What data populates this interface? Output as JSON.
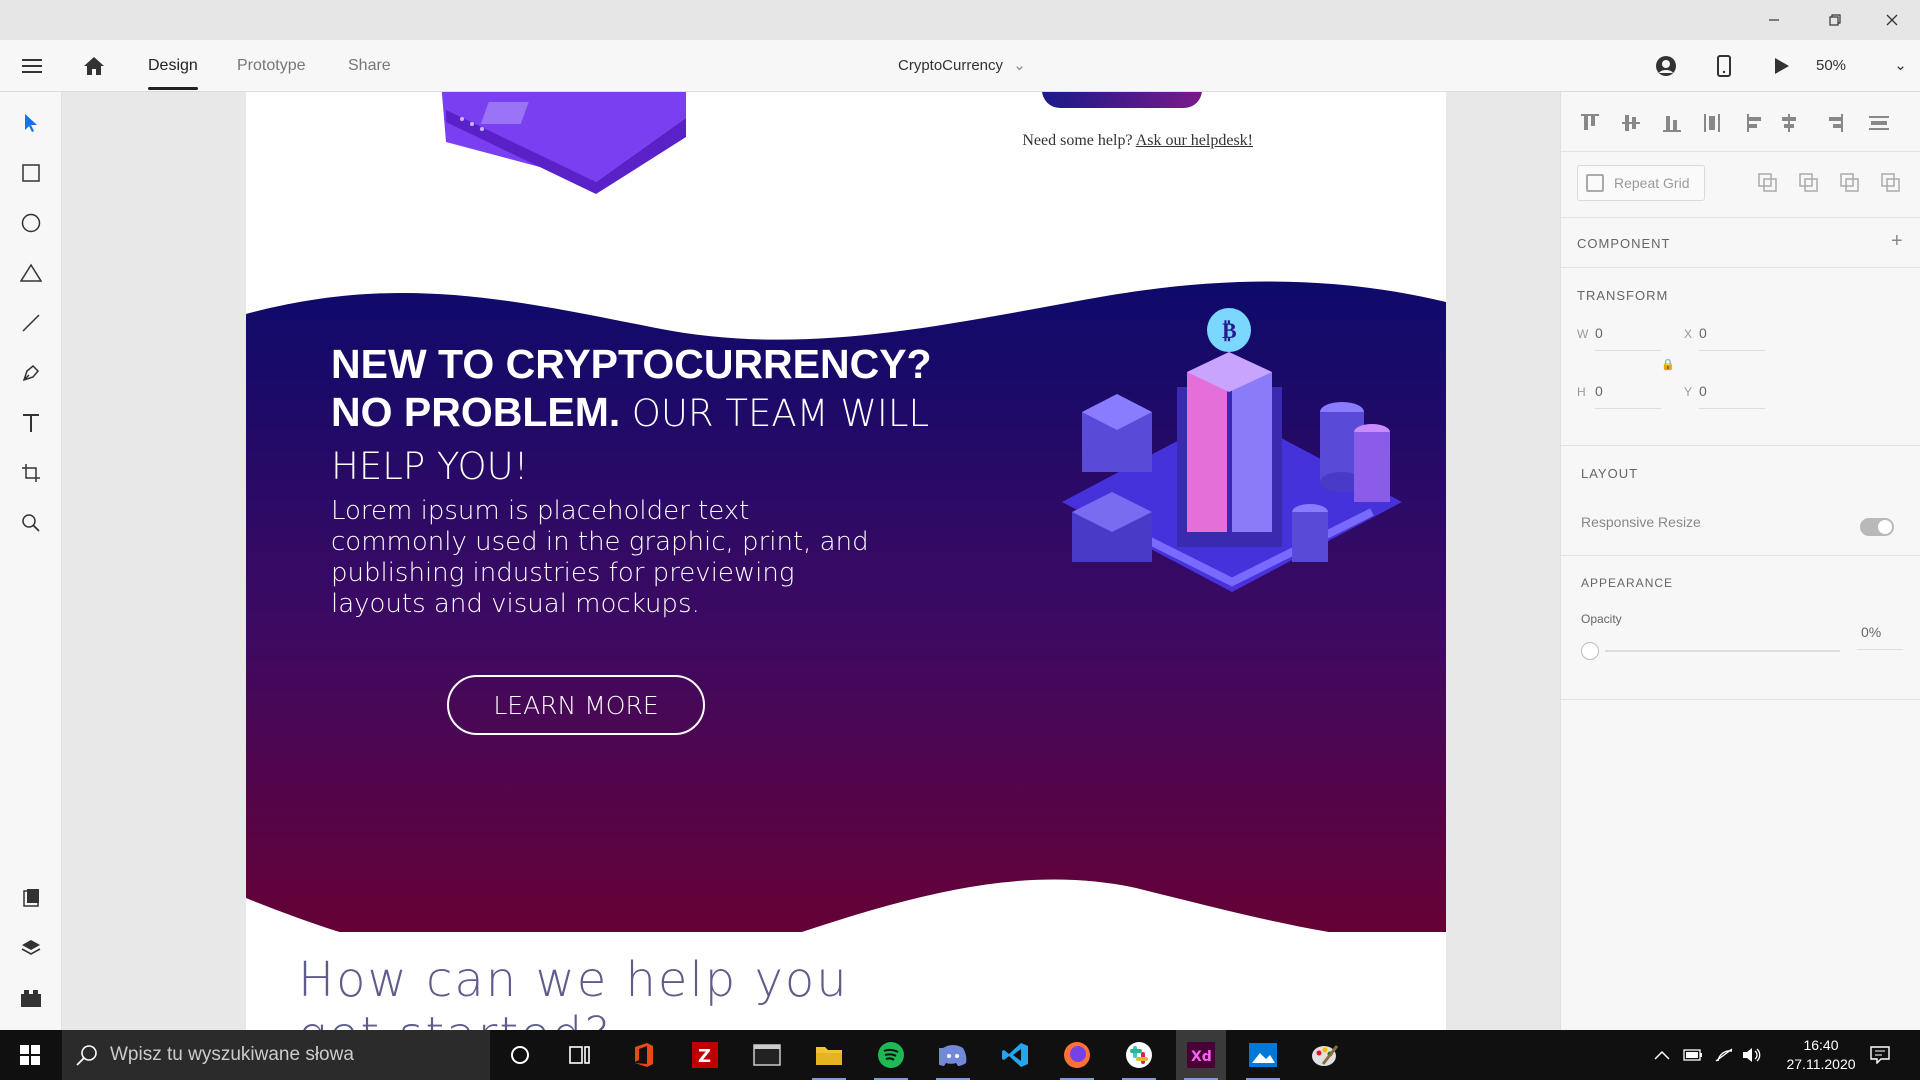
{
  "window": {
    "minimize_icon": "minimize-icon",
    "restore_icon": "restore-icon",
    "close_icon": "close-icon"
  },
  "toolbar": {
    "tabs": [
      {
        "label": "Design",
        "active": true
      },
      {
        "label": "Prototype",
        "active": false
      },
      {
        "label": "Share",
        "active": false
      }
    ],
    "document_title": "CryptoCurrency",
    "zoom": "50%"
  },
  "left_tools": [
    "select-icon",
    "rectangle-icon",
    "ellipse-icon",
    "triangle-icon",
    "line-icon",
    "pen-icon",
    "text-icon",
    "artboard-icon",
    "zoom-icon",
    "assets-icon",
    "layers-icon",
    "plugins-icon"
  ],
  "artboard": {
    "help_prefix": "Need some help?",
    "help_link": "Ask our helpdesk!",
    "headline_bold_1": "NEW TO CRYPTOCURRENCY?",
    "headline_bold_2": "NO PROBLEM.",
    "headline_thin_1": "OUR TEAM WILL",
    "headline_thin_2": "HELP YOU!",
    "lorem": "Lorem ipsum is placeholder text commonly used in the graphic, print, and publishing industries for previewing layouts and visual mockups.",
    "learn_more": "LEARN MORE",
    "section_title_1": "How can we help you",
    "section_title_2": "get started?",
    "gradient_top": "#0d0a6b",
    "gradient_bottom": "#6b0030"
  },
  "right_panel": {
    "repeat_grid": "Repeat Grid",
    "component": "COMPONENT",
    "transform": "TRANSFORM",
    "w_label": "W",
    "w_value": "0",
    "x_label": "X",
    "x_value": "0",
    "h_label": "H",
    "h_value": "0",
    "y_label": "Y",
    "y_value": "0",
    "layout": "LAYOUT",
    "responsive_resize": "Responsive Resize",
    "appearance": "APPEARANCE",
    "opacity_label": "Opacity",
    "opacity_value": "0%"
  },
  "taskbar": {
    "search_placeholder": "Wpisz tu wyszukiwane słowa",
    "time": "16:40",
    "date": "27.11.2020",
    "apps": [
      "cortana-icon",
      "task-view-icon",
      "office-icon",
      "filezilla-icon",
      "terminal-icon",
      "file-explorer-icon",
      "spotify-icon",
      "discord-icon",
      "vscode-icon",
      "firefox-icon",
      "slack-icon",
      "adobe-xd-icon",
      "photos-icon",
      "paint-icon"
    ]
  }
}
